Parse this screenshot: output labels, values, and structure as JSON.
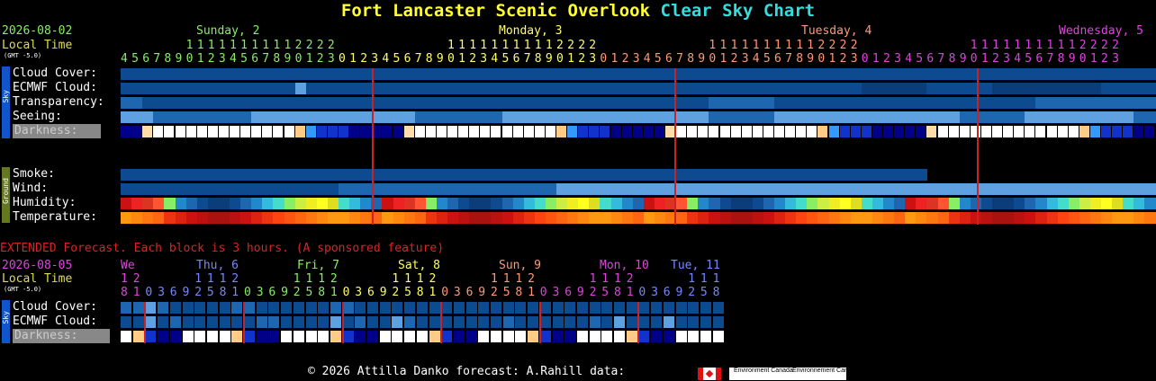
{
  "title": {
    "name": "Fort Lancaster Scenic Overlook",
    "part1": "Clear",
    "part2": "Sky Chart"
  },
  "top": {
    "date": "2026-08-02",
    "local_time": "Local Time",
    "gmt": "(GMT -5.0)",
    "days": [
      {
        "label": "Sunday, 2",
        "color": "#88ee66"
      },
      {
        "label": "Monday, 3",
        "color": "#ffff66"
      },
      {
        "label": "Tuesday, 4",
        "color": "#ff9977"
      },
      {
        "label": "Wednesday, 5",
        "color": "#dd44dd"
      }
    ],
    "tens": "          1111111111112222  1111111111112222  1111111111112222      1111",
    "ones": "456789012345678901230123456789012345678901230123456789012345678901230123456789012345678901230123",
    "rows": [
      "Cloud Cover:",
      "ECMWF Cloud:",
      "Transparency:",
      "Seeing:",
      "Darkness:"
    ],
    "ground_rows": [
      "Smoke:",
      "Wind:",
      "Humidity:",
      "Temperature:"
    ],
    "sky_tab": "Sky",
    "ground_tab": "Ground"
  },
  "extended": {
    "heading": "EXTENDED Forecast. Each block is 3 hours. (A sponsored feature)",
    "date": "2026-08-05",
    "local_time": "Local Time",
    "gmt": "(GMT -5.0)",
    "days": [
      {
        "label": "We",
        "color": "#dd44dd"
      },
      {
        "label": "Thu, 6",
        "color": "#7788ff"
      },
      {
        "label": "Fri, 7",
        "color": "#88ee66"
      },
      {
        "label": "Sat, 8",
        "color": "#ffff66"
      },
      {
        "label": "Sun, 9",
        "color": "#ff9977"
      },
      {
        "label": "Mon, 10",
        "color": "#dd44dd"
      },
      {
        "label": "Tue, 11",
        "color": "#7788ff"
      }
    ],
    "tens": "1 1 2",
    "ones": "6 9 2",
    "rows": [
      "Cloud Cover:",
      "ECMWF Cloud:",
      "Darkness:"
    ],
    "sky_tab": "Sky"
  },
  "footer": {
    "text": "© 2026 Attilla Danko  forecast: A.Rahill  data:",
    "env1": "Environment Canada",
    "env2": "Environnement Canada"
  },
  "colors": {
    "dark_blue": "#0d4a8f",
    "mid_blue": "#1f66b0",
    "light_blue": "#5fa0e0",
    "red_line": "#cc2222"
  }
}
